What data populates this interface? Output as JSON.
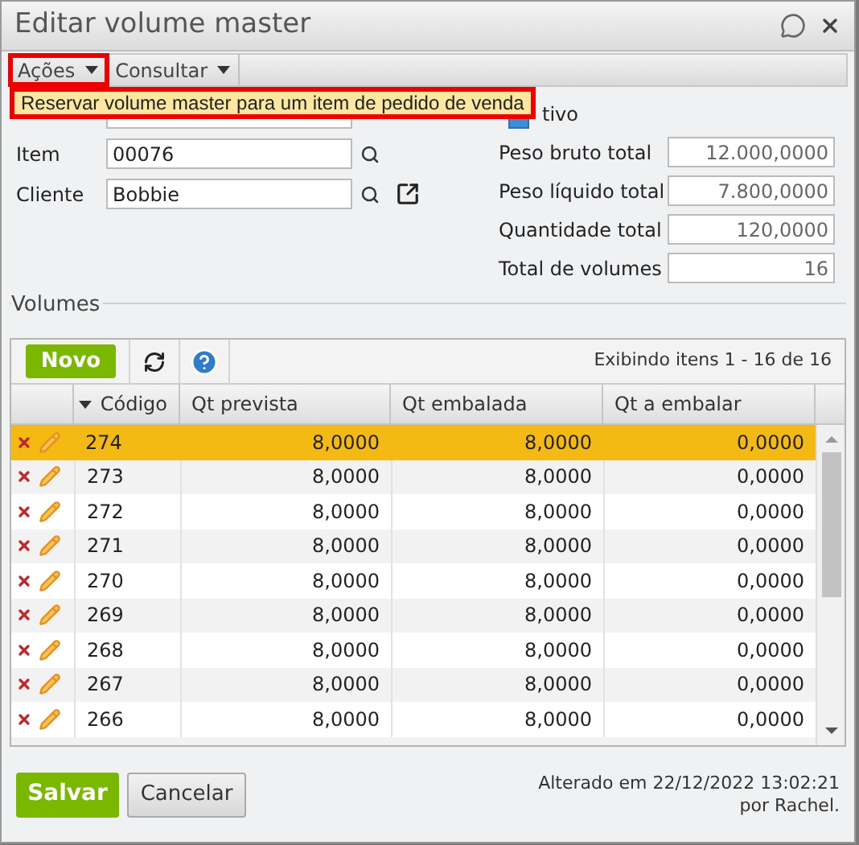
{
  "window": {
    "title": "Editar volume master"
  },
  "menubar": [
    {
      "label": "Ações",
      "highlighted": true
    },
    {
      "label": "Consultar",
      "highlighted": false
    }
  ],
  "dropdown": {
    "items": [
      {
        "label": "Reservar volume master para um item de pedido de venda",
        "highlighted": true
      }
    ]
  },
  "form": {
    "active_checkbox": {
      "label": "tivo",
      "checked": true
    },
    "left_fields": [
      {
        "label": "Item",
        "value": "00076",
        "link": false
      },
      {
        "label": "Cliente",
        "value": "Bobbie",
        "link": true
      }
    ],
    "right_fields": [
      {
        "label": "Peso bruto total",
        "value": "12.000,0000"
      },
      {
        "label": "Peso líquido total",
        "value": "7.800,0000"
      },
      {
        "label": "Quantidade total",
        "value": "120,0000"
      },
      {
        "label": "Total de volumes",
        "value": "16"
      }
    ]
  },
  "volumes": {
    "legend": "Volumes",
    "new_button": "Novo",
    "paging": "Exibindo itens 1 - 16 de 16",
    "columns": [
      "Código",
      "Qt prevista",
      "Qt embalada",
      "Qt a embalar"
    ],
    "rows": [
      {
        "cells": [
          "274",
          "8,0000",
          "8,0000",
          "0,0000"
        ],
        "selected": true
      },
      {
        "cells": [
          "273",
          "8,0000",
          "8,0000",
          "0,0000"
        ],
        "selected": false
      },
      {
        "cells": [
          "272",
          "8,0000",
          "8,0000",
          "0,0000"
        ],
        "selected": false
      },
      {
        "cells": [
          "271",
          "8,0000",
          "8,0000",
          "0,0000"
        ],
        "selected": false
      },
      {
        "cells": [
          "270",
          "8,0000",
          "8,0000",
          "0,0000"
        ],
        "selected": false
      },
      {
        "cells": [
          "269",
          "8,0000",
          "8,0000",
          "0,0000"
        ],
        "selected": false
      },
      {
        "cells": [
          "268",
          "8,0000",
          "8,0000",
          "0,0000"
        ],
        "selected": false
      },
      {
        "cells": [
          "267",
          "8,0000",
          "8,0000",
          "0,0000"
        ],
        "selected": false
      },
      {
        "cells": [
          "266",
          "8,0000",
          "8,0000",
          "0,0000"
        ],
        "selected": false
      }
    ]
  },
  "footer": {
    "save": "Salvar",
    "cancel": "Cancelar",
    "modified": "Alterado em 22/12/2022 13:02:21",
    "modified_by": "por Rachel."
  }
}
